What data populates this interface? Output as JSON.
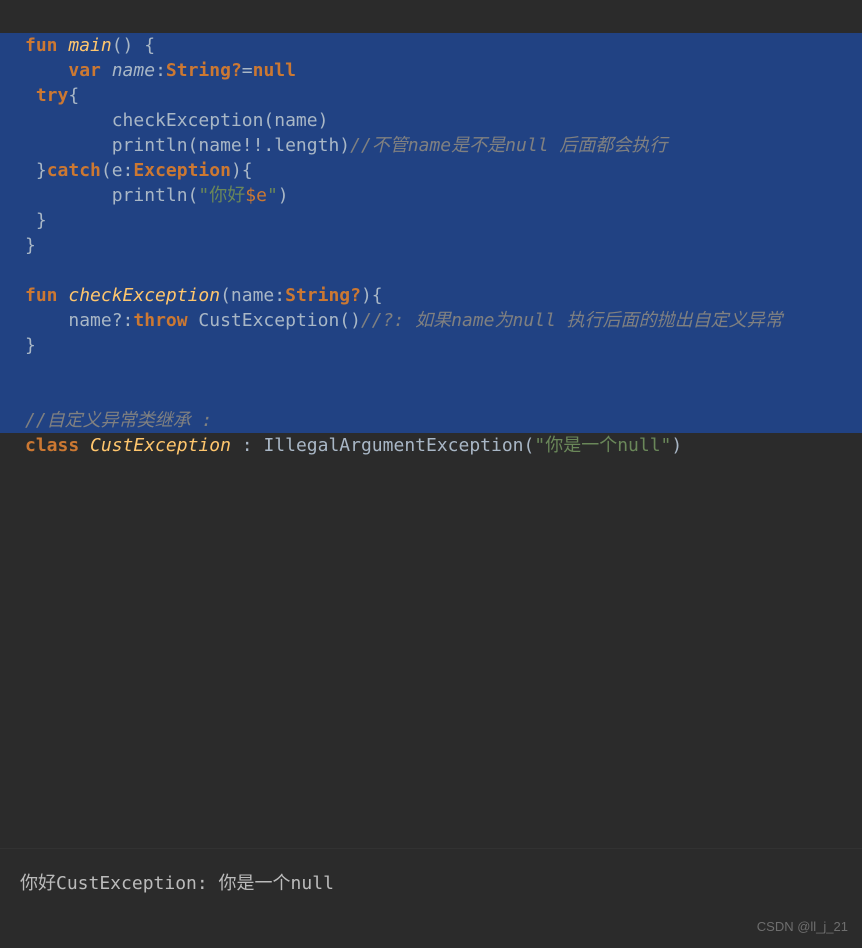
{
  "code": {
    "l1": {
      "fun": "fun",
      "main": "main",
      "rest": "() {"
    },
    "l2": {
      "var": "var",
      "name": "name",
      "colon": ":",
      "type": "String?",
      "eq": "=",
      "null": "null"
    },
    "l3": {
      "try": "try",
      "brace": "{"
    },
    "l4": {
      "call": "checkException(name)"
    },
    "l5": {
      "call": "println(name!!.length)",
      "cmt": "//不管name是不是null 后面都会执行"
    },
    "l6": {
      "brace1": "}",
      "catch": "catch",
      "paren1": "(e:",
      "type": "Exception",
      "paren2": "){"
    },
    "l7": {
      "print": "println(",
      "str1": "\"你好",
      "dollar": "$e",
      "str2": "\"",
      "close": ")"
    },
    "l8": {
      "brace": "}"
    },
    "l9": {
      "brace": "}"
    },
    "l11": {
      "fun": "fun",
      "name": "checkException",
      "sig1": "(name:",
      "type": "String?",
      "sig2": "){"
    },
    "l12": {
      "expr": "name?:",
      "throw": "throw",
      "call": " CustException()",
      "cmt": "//?: 如果name为null 执行后面的抛出自定义异常"
    },
    "l13": {
      "brace": "}"
    },
    "l15": {
      "cmt": "//自定义异常类继承 :"
    },
    "l16": {
      "class": "class",
      "name": "CustException",
      "colon": " : ",
      "parent": "IllegalArgumentException(",
      "str": "\"你是一个null\"",
      "close": ")"
    }
  },
  "output": {
    "text": "你好CustException: 你是一个null"
  },
  "watermark": "CSDN @ll_j_21"
}
